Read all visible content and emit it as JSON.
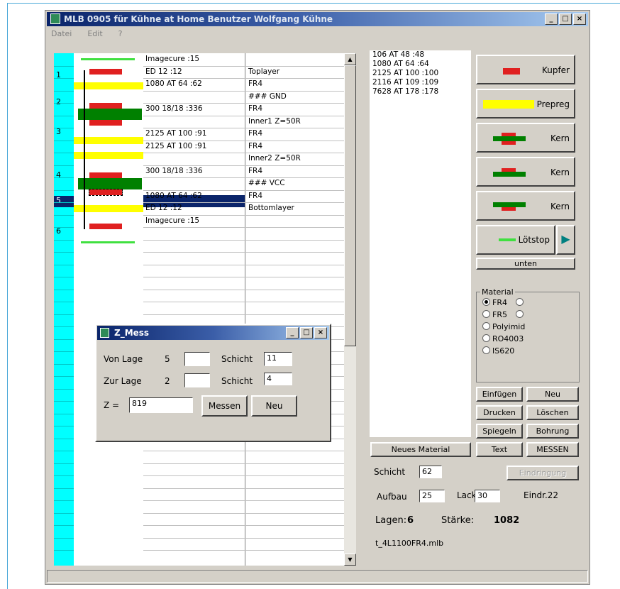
{
  "window": {
    "title": "MLB 0905  für Kühne at Home Benutzer Wolfgang Kühne",
    "controls": [
      "_",
      "□",
      "×"
    ]
  },
  "menu": [
    "Datei",
    "Edit",
    "?"
  ],
  "layer_numbers": [
    "1",
    "2",
    "3",
    "4",
    "5",
    "6"
  ],
  "stack": [
    {
      "material": "Imagecure     :15",
      "type": ""
    },
    {
      "material": "ED 12    :12",
      "type": "Toplayer"
    },
    {
      "material": "1080 AT  64 :62",
      "type": "FR4"
    },
    {
      "material": "",
      "type": "### GND"
    },
    {
      "material": "300 18/18 :336",
      "type": "FR4"
    },
    {
      "material": "",
      "type": "Inner1  Z=50R"
    },
    {
      "material": "2125 AT 100 :91",
      "type": "FR4"
    },
    {
      "material": "2125 AT 100 :91",
      "type": "FR4"
    },
    {
      "material": "",
      "type": "Inner2  Z=50R"
    },
    {
      "material": "300 18/18 :336",
      "type": "FR4"
    },
    {
      "material": "",
      "type": "### VCC"
    },
    {
      "material": "1080 AT  64 :62",
      "type": "FR4"
    },
    {
      "material": "ED 12    :12",
      "type": "Bottomlayer"
    },
    {
      "material": "Imagecure     :15",
      "type": ""
    }
  ],
  "material_list": [
    "106 AT    48 :48",
    "1080 AT   64 :64",
    "2125 AT 100 :100",
    "2116 AT 109 :109",
    "7628 AT 178 :178"
  ],
  "buttons": {
    "kupfer": "Kupfer",
    "prepreg": "Prepreg",
    "kern1": "Kern",
    "kern2": "Kern",
    "kern3": "Kern",
    "loetstop": "Lötstop",
    "unten": "unten",
    "einfuegen": "Einfügen",
    "neu": "Neu",
    "drucken": "Drucken",
    "loeschen": "Löschen",
    "spiegeln": "Spiegeln",
    "bohrung": "Bohrung",
    "neues_material": "Neues Material",
    "text": "Text",
    "messen": "MESSEN",
    "eindringung": "Eindringung"
  },
  "material_group": {
    "title": "Material",
    "options": [
      {
        "label": "FR4",
        "selected": true,
        "extra": true
      },
      {
        "label": "FR5",
        "selected": false,
        "extra": true
      },
      {
        "label": "Polyimid",
        "selected": false,
        "extra": false
      },
      {
        "label": "RO4003",
        "selected": false,
        "extra": false
      },
      {
        "label": "IS620",
        "selected": false,
        "extra": false
      }
    ]
  },
  "info": {
    "schicht_label": "Schicht",
    "schicht_value": "62",
    "aufbau_label": "Aufbau",
    "aufbau_value": "25",
    "lack_label": "Lack",
    "lack_value": "30",
    "eindr_label": "Eindr.22",
    "lagen_label": "Lagen:",
    "lagen_value": "6",
    "staerke_label": "Stärke:",
    "staerke_value": "1082",
    "filename": "t_4L1100FR4.mlb"
  },
  "popup": {
    "title": "Z_Mess",
    "von_lage_label": "Von Lage",
    "von_lage_value": "5",
    "zur_lage_label": "Zur Lage",
    "zur_lage_value": "2",
    "schicht_label": "Schicht",
    "schicht1_value": "11",
    "schicht2_value": "4",
    "z_label": "Z =",
    "z_value": "819",
    "messen": "Messen",
    "neu": "Neu"
  },
  "colors": {
    "copper": "#e02020",
    "prepreg": "#ffff00",
    "core": "#008000",
    "loetstop": "#40e040",
    "ruler": "#00ffff",
    "selection": "#0a246a"
  }
}
